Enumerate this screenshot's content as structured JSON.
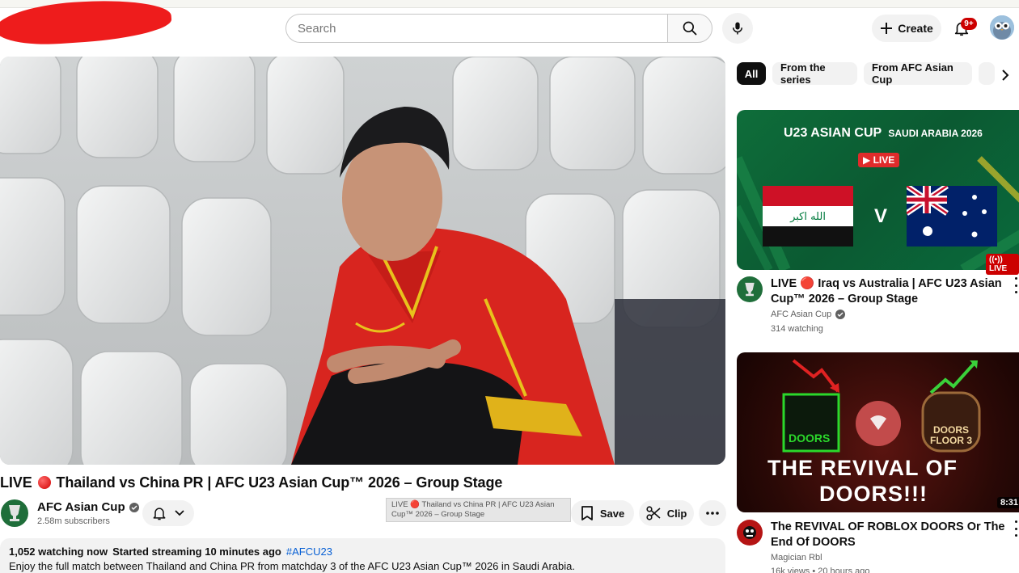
{
  "header": {
    "search_placeholder": "Search",
    "create_label": "Create",
    "notification_count": "9+"
  },
  "video": {
    "title_prefix": "LIVE",
    "title_rest": "Thailand vs China PR | AFC U23 Asian Cup™ 2026 – Group Stage",
    "channel": "AFC Asian Cup",
    "subscribers": "2.58m subscribers",
    "tooltip": "LIVE 🔴 Thailand vs China PR | AFC U23 Asian Cup™ 2026 – Group Stage",
    "save_label": "Save",
    "clip_label": "Clip",
    "watching": "1,052 watching now",
    "started": "Started streaming 10 minutes ago",
    "hashtag": "#AFCU23",
    "description": "Enjoy the full match between Thailand and China PR from matchday 3 of the AFC U23 Asian Cup™ 2026 in Saudi Arabia."
  },
  "chips": [
    "All",
    "From the series",
    "From AFC Asian Cup"
  ],
  "sidebar": {
    "cards": [
      {
        "thumb_brand": "U23 ASIAN CUP",
        "thumb_sub": "SAUDI ARABIA 2026",
        "thumb_live": "LIVE",
        "thumb_vs": "V",
        "badge": "LIVE",
        "title": "LIVE 🔴 Iraq vs Australia | AFC U23 Asian Cup™ 2026 – Group Stage",
        "channel": "AFC Asian Cup",
        "meta": "314 watching"
      },
      {
        "thumb_left": "DOORS",
        "thumb_right": "DOORS FLOOR 3",
        "thumb_big1": "THE REVIVAL OF",
        "thumb_big2": "DOORS!!!",
        "badge": "8:31",
        "title": "The REVIVAL OF ROBLOX DOORS Or The End Of DOORS",
        "channel": "Magician Rbl",
        "meta": "16k views • 20 hours ago"
      }
    ]
  },
  "colors": {
    "live_red": "#cc0000",
    "link_blue": "#065fd4",
    "chip_bg": "#f2f2f2"
  }
}
